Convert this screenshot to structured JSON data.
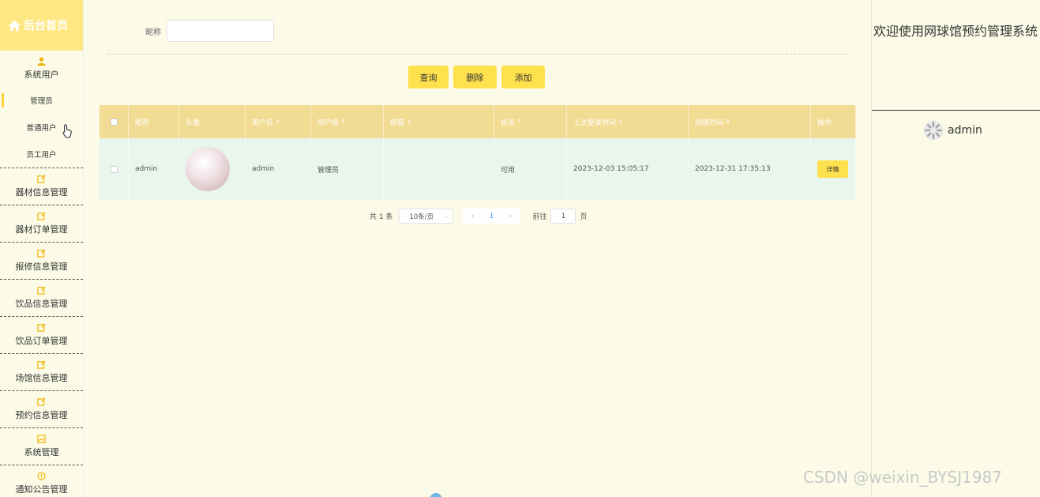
{
  "sidebar": {
    "home_label": "后台首页",
    "groups": [
      {
        "label": "系统用户",
        "icon": "user-icon",
        "items": [
          "管理员",
          "普通用户",
          "员工用户"
        ]
      },
      {
        "label": "器材信息管理",
        "icon": "edit-icon"
      },
      {
        "label": "器材订单管理",
        "icon": "edit-icon"
      },
      {
        "label": "报修信息管理",
        "icon": "edit-icon"
      },
      {
        "label": "饮品信息管理",
        "icon": "edit-icon"
      },
      {
        "label": "饮品订单管理",
        "icon": "edit-icon"
      },
      {
        "label": "场馆信息管理",
        "icon": "edit-icon"
      },
      {
        "label": "预约信息管理",
        "icon": "edit-icon"
      },
      {
        "label": "系统管理",
        "icon": "image-icon"
      },
      {
        "label": "通知公告管理",
        "icon": "info-icon"
      }
    ]
  },
  "search": {
    "label": "昵称",
    "value": ""
  },
  "buttons": {
    "query": "查询",
    "delete": "删除",
    "add": "添加"
  },
  "table": {
    "headers": [
      "昵称",
      "头像",
      "用户名",
      "用户组",
      "邮箱",
      "状态",
      "上次登录时间",
      "创建时间",
      "操作"
    ],
    "rows": [
      {
        "nickname": "admin",
        "username": "admin",
        "group": "管理员",
        "email": "",
        "status": "可用",
        "last_login": "2023-12-03 15:05:17",
        "created": "2023-12-31 17:35:13",
        "action": "详情"
      }
    ]
  },
  "pagination": {
    "total": "共 1 条",
    "page_size": "10条/页",
    "current_page": "1",
    "goto_label": "前往",
    "goto_value": "1",
    "page_suffix": "页"
  },
  "header": {
    "welcome": "欢迎使用网球馆预约管理系统",
    "username": "admin"
  },
  "watermark": "CSDN @weixin_BYSJ1987",
  "colors": {
    "accent": "#ffe04d",
    "table_head": "#f2dc94",
    "row_bg": "#e8f6ee",
    "background": "#fbfbe8"
  }
}
